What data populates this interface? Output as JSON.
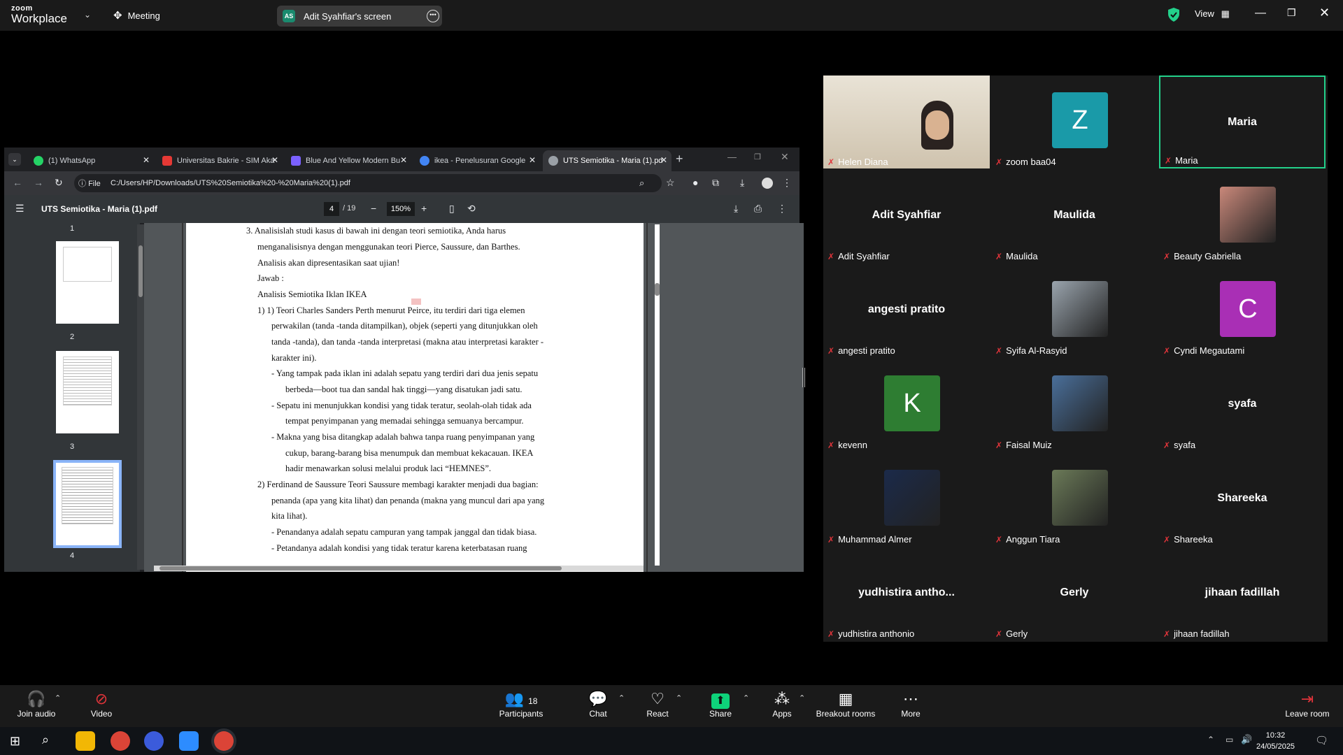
{
  "zoom": {
    "logo_line1": "zoom",
    "logo_line2": "Workplace",
    "meeting_label": "Meeting",
    "share_chip": "AS",
    "share_label": "Adit Syahfiar's screen",
    "view_label": "View"
  },
  "browser": {
    "tabs": [
      {
        "label": "(1) WhatsApp",
        "icon": "whatsapp-icon",
        "color": "#25d366"
      },
      {
        "label": "Universitas Bakrie - SIM Aka",
        "icon": "university-icon",
        "color": "#e53935"
      },
      {
        "label": "Blue And Yellow Modern Bu",
        "icon": "canva-icon",
        "color": "#7b61ff"
      },
      {
        "label": "ikea - Penelusuran Google",
        "icon": "google-icon",
        "color": "#4285f4"
      },
      {
        "label": "UTS Semiotika - Maria (1).pd",
        "icon": "pdf-icon",
        "color": "#9aa0a6"
      }
    ],
    "file_badge": "File",
    "url": "C:/Users/HP/Downloads/UTS%20Semiotika%20-%20Maria%20(1).pdf"
  },
  "pdf": {
    "title": "UTS Semiotika - Maria (1).pdf",
    "current_page": "4",
    "total_pages": "/ 19",
    "zoom": "150%",
    "thumbnail_numbers": [
      "1",
      "2",
      "3",
      "4"
    ],
    "lines": [
      "3.  Analisislah studi kasus di bawah ini dengan teori semiotika, Anda harus",
      "menganalisisnya dengan menggunakan teori Pierce, Saussure, dan Barthes.",
      "Analisis akan dipresentasikan saat ujian!",
      "Jawab :",
      "Analisis Semiotika Iklan IKEA",
      "1)  1) Teori Charles Sanders Perth menurut Peirce, itu terdiri dari tiga elemen",
      "perwakilan (tanda -tanda ditampilkan), objek (seperti yang ditunjukkan oleh",
      "tanda -tanda), dan tanda -tanda interpretasi (makna atau interpretasi karakter -",
      "karakter ini).",
      "-     Yang tampak pada iklan ini adalah sepatu yang terdiri dari dua jenis sepatu",
      "berbeda—boot tua dan sandal hak tinggi—yang disatukan jadi satu.",
      "-     Sepatu ini menunjukkan kondisi yang tidak teratur, seolah-olah tidak ada",
      "tempat penyimpanan yang memadai sehingga semuanya bercampur.",
      "-     Makna yang bisa ditangkap adalah bahwa tanpa ruang penyimpanan yang",
      "cukup, barang-barang bisa menumpuk dan membuat kekacauan. IKEA",
      "hadir menawarkan solusi melalui produk laci “HEMNES”.",
      "2)  Ferdinand de Saussure Teori Saussure membagi karakter menjadi dua bagian:",
      "penanda (apa yang kita lihat) dan penanda (makna yang muncul dari apa yang",
      "kita lihat).",
      "-     Penandanya adalah sepatu campuran yang tampak janggal dan tidak biasa.",
      "-     Petandanya adalah kondisi yang tidak teratur karena keterbatasan ruang"
    ]
  },
  "participants": [
    {
      "name": "Helen Diana",
      "display": "",
      "type": "video",
      "color": "#c8b6a0"
    },
    {
      "name": "zoom baa04",
      "display": "Z",
      "type": "avatar",
      "color": "#1a9aa8"
    },
    {
      "name": "Maria",
      "display": "Maria",
      "type": "name",
      "color": ""
    },
    {
      "name": "Adit Syahfiar",
      "display": "Adit Syahfiar",
      "type": "name",
      "color": ""
    },
    {
      "name": "Maulida",
      "display": "Maulida",
      "type": "name",
      "color": ""
    },
    {
      "name": "Beauty Gabriella",
      "display": "",
      "type": "photo",
      "color": "#c9887a"
    },
    {
      "name": "angesti pratito",
      "display": "angesti pratito",
      "type": "name",
      "color": ""
    },
    {
      "name": "Syifa Al-Rasyid",
      "display": "",
      "type": "photo",
      "color": "#9aa4ad"
    },
    {
      "name": "Cyndi Megautami",
      "display": "C",
      "type": "avatar",
      "color": "#a92fb5"
    },
    {
      "name": "kevenn",
      "display": "K",
      "type": "avatar",
      "color": "#2e7d32"
    },
    {
      "name": "Faisal Muiz",
      "display": "",
      "type": "photo",
      "color": "#4a6f9a"
    },
    {
      "name": "syafa",
      "display": "syafa",
      "type": "name",
      "color": ""
    },
    {
      "name": "Muhammad Almer",
      "display": "",
      "type": "photo",
      "color": "#1b2a4a"
    },
    {
      "name": "Anggun Tiara",
      "display": "",
      "type": "photo",
      "color": "#6b7a58"
    },
    {
      "name": "Shareeka",
      "display": "Shareeka",
      "type": "name",
      "color": ""
    },
    {
      "name": "yudhistira anthonio",
      "display": "yudhistira  antho...",
      "type": "name",
      "color": ""
    },
    {
      "name": "Gerly",
      "display": "Gerly",
      "type": "name",
      "color": ""
    },
    {
      "name": "jihaan fadillah",
      "display": "jihaan fadillah",
      "type": "name",
      "color": ""
    }
  ],
  "toolbar": {
    "join_audio": "Join audio",
    "video": "Video",
    "participants_count": "18",
    "participants": "Participants",
    "chat": "Chat",
    "react": "React",
    "share": "Share",
    "apps": "Apps",
    "breakout": "Breakout rooms",
    "more": "More",
    "leave": "Leave room"
  },
  "taskbar": {
    "time": "10:32",
    "date": "24/05/2025"
  },
  "colors": {
    "accent_green": "#23d18b",
    "mic_muted": "#e0343a",
    "share_green": "#0ed27a"
  }
}
